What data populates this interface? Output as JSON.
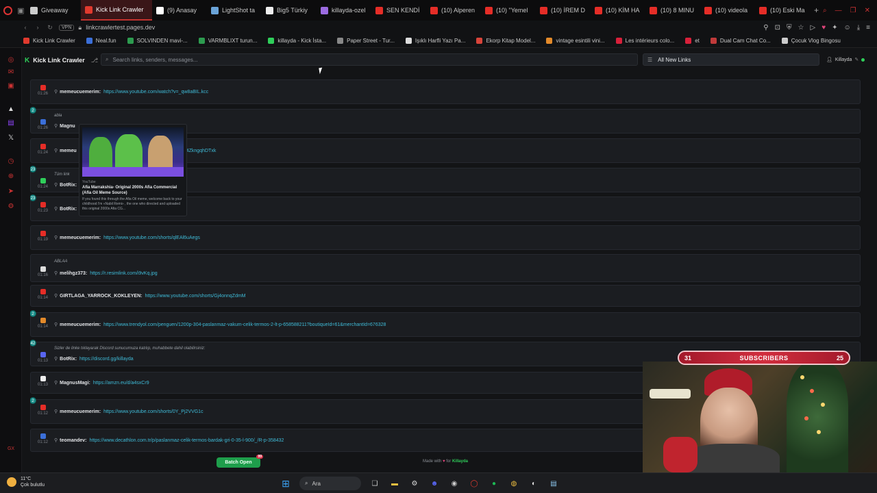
{
  "browser": {
    "tabs": [
      {
        "label": "Giveaway",
        "icon": "gift-icon",
        "color": "#cccccc",
        "active": false
      },
      {
        "label": "Kick Link Crawler",
        "icon": "kick-icon",
        "color": "#e03a2e",
        "active": true
      },
      {
        "label": "(9) Anasay",
        "icon": "x-icon",
        "color": "#ffffff",
        "active": false
      },
      {
        "label": "LightShot ta",
        "icon": "feather-icon",
        "color": "#6aa3d8",
        "active": false
      },
      {
        "label": "Big5 Türkiy",
        "icon": "doc-icon",
        "color": "#eeeeee",
        "active": false
      },
      {
        "label": "killayda-ozel",
        "icon": "diamond-icon",
        "color": "#9b6be0",
        "active": false
      },
      {
        "label": "SEN KENDİ",
        "icon": "youtube-icon",
        "color": "#e52d27",
        "active": false
      },
      {
        "label": "(10) Alperen",
        "icon": "youtube-icon",
        "color": "#e52d27",
        "active": false
      },
      {
        "label": "(10) \"Yemel",
        "icon": "youtube-icon",
        "color": "#e52d27",
        "active": false
      },
      {
        "label": "(10) İREM D",
        "icon": "youtube-icon",
        "color": "#e52d27",
        "active": false
      },
      {
        "label": "(10) KİM HA",
        "icon": "youtube-icon",
        "color": "#e52d27",
        "active": false
      },
      {
        "label": "(10) 8 MINU",
        "icon": "youtube-icon",
        "color": "#e52d27",
        "active": false
      },
      {
        "label": "(10) videola",
        "icon": "youtube-icon",
        "color": "#e52d27",
        "active": false
      },
      {
        "label": "(10) Eski Ma",
        "icon": "youtube-icon",
        "color": "#e52d27",
        "active": false
      }
    ],
    "vpn_label": "VPN",
    "url": "linkcrawlertest.pages.dev",
    "bookmarks": [
      {
        "label": "Kick Link Crawler",
        "color": "#e03a2e"
      },
      {
        "label": "Neal.fun",
        "color": "#3b6fd8"
      },
      {
        "label": "SOLVINDEN mavi-...",
        "color": "#2d9b4f"
      },
      {
        "label": "VARMBLIXT turun...",
        "color": "#2d9b4f"
      },
      {
        "label": "killayda - Kick İsta...",
        "color": "#2fce5a"
      },
      {
        "label": "Paper Street - Tur...",
        "color": "#888888"
      },
      {
        "label": "Işıklı Harfli Yazı Pa...",
        "color": "#dddddd"
      },
      {
        "label": "Ekorp Kitap Model...",
        "color": "#d8443a"
      },
      {
        "label": "vintage esintili vini...",
        "color": "#e38a2a"
      },
      {
        "label": "Les intérieurs colo...",
        "color": "#d8203a"
      },
      {
        "label": "et",
        "color": "#d8203a"
      },
      {
        "label": "Dual Cam Chat Co...",
        "color": "#c03a3a"
      },
      {
        "label": "Çocuk Vlog Bingosu",
        "color": "#cccccc"
      }
    ]
  },
  "app": {
    "brand": "Kick Link Crawler",
    "brand_logo": "K",
    "search_placeholder": "Search links, senders, messages...",
    "filter_label": "All New Links",
    "user": "Killayda",
    "accent": "#2fce5a",
    "link_color": "#3fbcd9"
  },
  "messages": [
    {
      "time": "01:26",
      "sender": "memeucuemerim:",
      "link": "https://www.youtube.com/watch?v=_qw8aBIL.kcc",
      "context": "",
      "badge": "",
      "icon_color": "#e52d27"
    },
    {
      "time": "01:26",
      "sender": "Magnu",
      "link": "",
      "context": "abla",
      "badge": "2",
      "icon_color": "#3b6fd8"
    },
    {
      "time": "01:24",
      "sender": "memeu",
      "link": "=4ZkngqhDTxk",
      "context": "",
      "badge": "",
      "icon_color": "#e52d27"
    },
    {
      "time": "01:24",
      "sender": "BotRix:",
      "link": "",
      "context": "Tüm link",
      "badge": "23",
      "icon_color": "#2fce5a"
    },
    {
      "time": "01:23",
      "sender": "BotRix:",
      "link": "",
      "context": "",
      "badge": "23",
      "icon_color": "#e52d27"
    },
    {
      "time": "01:19",
      "sender": "memeucuemerim:",
      "link": "https://www.youtube.com/shorts/qlEAl6uAegs",
      "context": "",
      "badge": "",
      "icon_color": "#e52d27"
    },
    {
      "time": "01:16",
      "sender": "melihgz373:",
      "link": "https://r.resimlink.com/i9vKq.jpg",
      "context": "ABLAA",
      "badge": "",
      "icon_color": "#dddddd"
    },
    {
      "time": "01:14",
      "sender": "GIRTLAGA_YARROCK_KOKLEYEN:",
      "link": "https://www.youtube.com/shorts/Gj4onnqZdmM",
      "context": "",
      "badge": "",
      "icon_color": "#e52d27"
    },
    {
      "time": "01:14",
      "sender": "memeucuemerim:",
      "link": "https://www.trendyol.com/penguen/1200p-304-paslanmaz-vakum-celik-termos-2-lt-p-658588211?boutiqueId=61&merchantId=676328",
      "context": "",
      "badge": "2",
      "icon_color": "#e38a2a"
    },
    {
      "time": "01:13",
      "sender": "BotRix:",
      "link": "https://discord.gg/killayda",
      "context": "Sizler de linke tıklayarak Discord sunucumuza katılıp, muhabbete dahil olabilirsiniz:",
      "badge": "42",
      "icon_color": "#5865f2"
    },
    {
      "time": "01:13",
      "sender": "MagnusMagi:",
      "link": "https://amzn.eu/d/a4sxCr9",
      "context": "",
      "badge": "",
      "icon_color": "#eeeeee"
    },
    {
      "time": "01:12",
      "sender": "memeucuemerim:",
      "link": "https://www.youtube.com/shorts/0Y_Pj2VVG1c",
      "context": "",
      "badge": "2",
      "icon_color": "#e52d27"
    },
    {
      "time": "01:12",
      "sender": "teomandev:",
      "link": "https://www.decathlon.com.tr/p/paslanmaz-celik-termos-bardak-gri-0-35-l-900/_/R-p-358432",
      "context": "",
      "badge": "",
      "icon_color": "#3b6fd8"
    }
  ],
  "preview": {
    "source": "YouTube",
    "title": "Afia Marrakshia- Original 2000s Afia Commercial (Afia Oil Meme Source)",
    "description": "If you found this through the Afia Oil meme, welcome back to your childhood I'm «Nabil Remi» , the one who directed and uploaded this original 2000s Afia CG..."
  },
  "footer": {
    "batch_label": "Batch Open",
    "batch_count": "99",
    "made_prefix": "Made with",
    "made_for": "for",
    "made_who": "Killayda"
  },
  "overlay": {
    "subs_left": "31",
    "subs_label": "SUBSCRIBERS",
    "subs_right": "25"
  },
  "taskbar": {
    "temperature": "11°C",
    "weather": "Çok bulutlu",
    "search_label": "Ara"
  }
}
